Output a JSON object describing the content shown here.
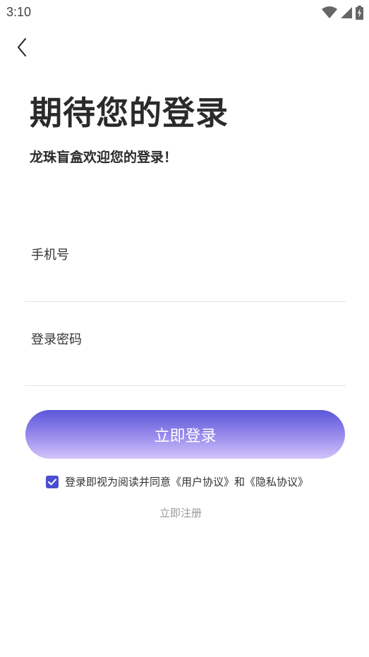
{
  "status_bar": {
    "time": "3:10",
    "icons": [
      "wifi-icon",
      "signal-icon",
      "battery-charging-icon"
    ]
  },
  "header": {
    "back_icon": "chevron-left-icon"
  },
  "title": "期待您的登录",
  "subtitle": "龙珠盲盒欢迎您的登录！",
  "form": {
    "phone_label": "手机号",
    "phone_value": "",
    "password_label": "登录密码",
    "password_value": ""
  },
  "login_button_label": "立即登录",
  "agreement": {
    "checked": true,
    "prefix": "登录即视为阅读并同意",
    "user_agreement": "《用户协议》",
    "conjunction": "和",
    "privacy_policy": "《隐私协议》"
  },
  "register_link": "立即注册",
  "colors": {
    "accent": "#4b4fd1",
    "button_gradient_top": "#5a57d8",
    "button_gradient_bottom": "#d2c3fb",
    "muted_text": "#9a9a9a"
  }
}
